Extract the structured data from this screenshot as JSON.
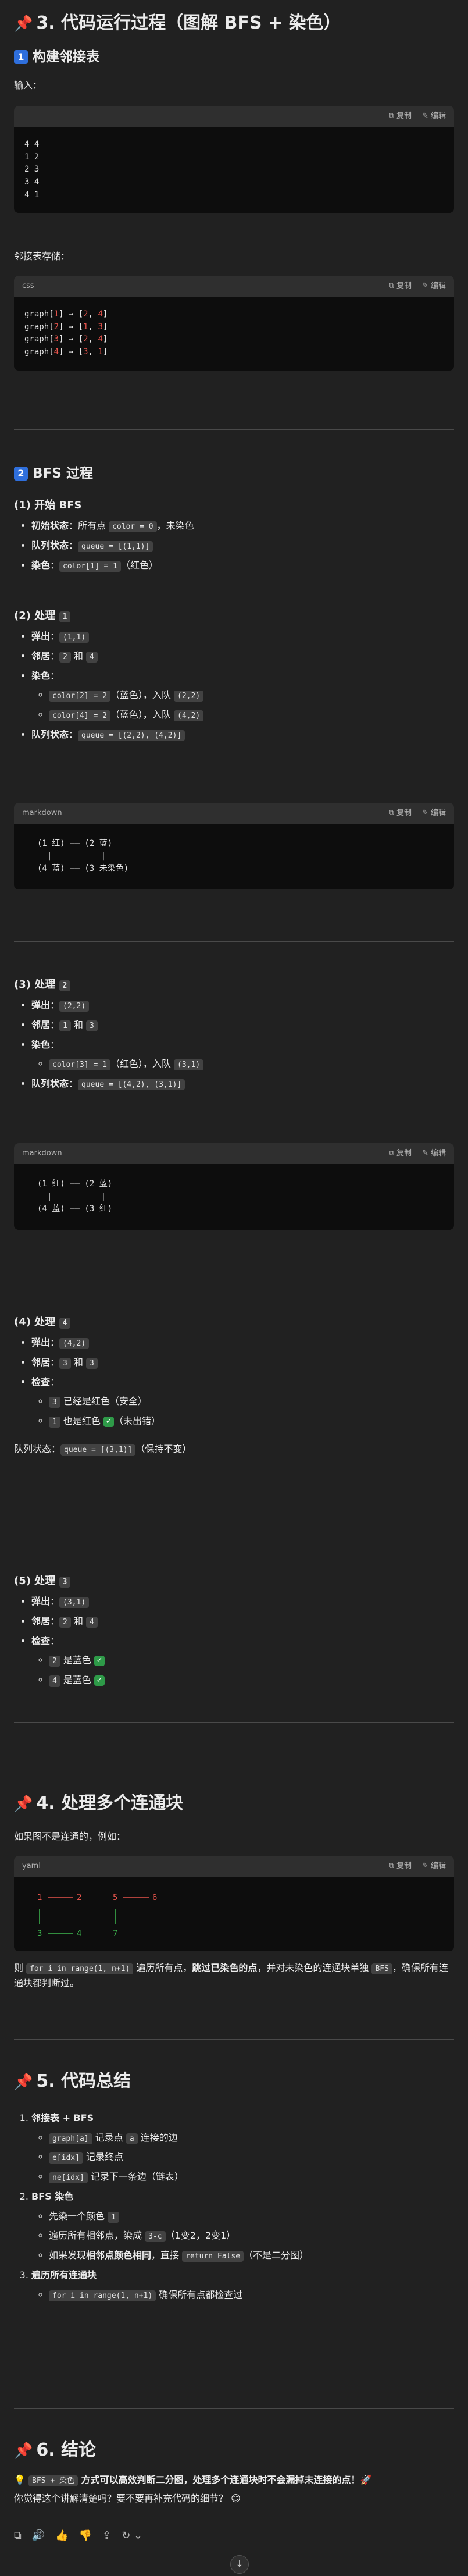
{
  "s3": {
    "title": "3. 代码运行过程（图解 BFS + 染色）",
    "build": {
      "num": "1",
      "title": "构建邻接表"
    },
    "input_label": "输入：",
    "code1": {
      "lang": "",
      "lines": [
        "4 4",
        "1 2",
        "2 3",
        "3 4",
        "4 1"
      ]
    },
    "adj_label": "邻接表存储：",
    "code2": {
      "lang": "css",
      "lines": [
        [
          "graph[",
          "1",
          "] → [",
          "2",
          ", ",
          "4",
          "]"
        ],
        [
          "graph[",
          "2",
          "] → [",
          "1",
          ", ",
          "3",
          "]"
        ],
        [
          "graph[",
          "3",
          "] → [",
          "2",
          ", ",
          "4",
          "]"
        ],
        [
          "graph[",
          "4",
          "] → [",
          "3",
          ", ",
          "1",
          "]"
        ]
      ]
    },
    "bfs": {
      "num": "2",
      "title": "BFS 过程"
    },
    "step1": {
      "title": "(1) 开始 BFS",
      "a_label": "初始状态",
      "a_text": "：所有点 ",
      "a_code": "color = 0",
      "a_tail": "，未染色",
      "b_label": "队列状态",
      "b_text": "：",
      "b_code": "queue = [(1,1)]",
      "c_label": "染色",
      "c_text": "：",
      "c_code": "color[1] = 1",
      "c_tail": "（红色）"
    },
    "step2": {
      "title": "(2) 处理 ",
      "node": "1",
      "pop_label": "弹出",
      "pop_code": "(1,1)",
      "nb_label": "邻居",
      "nb_a": "2",
      "nb_and": " 和 ",
      "nb_b": "4",
      "dye_label": "染色",
      "d1_code": "color[2] = 2",
      "d1_mid": "（蓝色），入队 ",
      "d1_q": "(2,2)",
      "d2_code": "color[4] = 2",
      "d2_mid": "（蓝色），入队 ",
      "d2_q": "(4,2)",
      "q_label": "队列状态",
      "q_code": "queue = [(2,2), (4,2)]",
      "diagram_lang": "markdown",
      "diagram": [
        "(1 红) —— (2 蓝)",
        "  |          |",
        "(4 蓝) —— (3 未染色)"
      ]
    },
    "step3": {
      "title": "(3) 处理 ",
      "node": "2",
      "pop_label": "弹出",
      "pop_code": "(2,2)",
      "nb_label": "邻居",
      "nb_a": "1",
      "nb_and": " 和 ",
      "nb_b": "3",
      "dye_label": "染色",
      "d1_code": "color[3] = 1",
      "d1_mid": "（红色），入队 ",
      "d1_q": "(3,1)",
      "q_label": "队列状态",
      "q_code": "queue = [(4,2), (3,1)]",
      "diagram_lang": "markdown",
      "diagram": [
        "(1 红) —— (2 蓝)",
        "  |          |",
        "(4 蓝) —— (3 红)"
      ]
    },
    "step4": {
      "title": "(4) 处理 ",
      "node": "4",
      "pop_label": "弹出",
      "pop_code": "(4,2)",
      "nb_label": "邻居",
      "nb_a": "3",
      "nb_and": " 和 ",
      "nb_b": "3",
      "check_label": "检查",
      "c1_code": "3",
      "c1_text": " 已经是红色（安全）",
      "c2_code": "1",
      "c2_text": " 也是红色 ",
      "c2_tail": "（未出错）",
      "q_label": "队列状态：",
      "q_code": "queue = [(3,1)]",
      "q_tail": "（保持不变）"
    },
    "step5": {
      "title": "(5) 处理 ",
      "node": "3",
      "pop_label": "弹出",
      "pop_code": "(3,1)",
      "nb_label": "邻居",
      "nb_a": "2",
      "nb_and": " 和 ",
      "nb_b": "4",
      "check_label": "检查",
      "c1_code": "2",
      "c1_text": " 是蓝色 ",
      "c2_code": "4",
      "c2_text": " 是蓝色 "
    }
  },
  "s4": {
    "title": "4. 处理多个连通块",
    "intro": "如果图不是连通的，例如：",
    "code_lang": "yaml",
    "p_pre": "则 ",
    "p_code1": "for i in range(1, n+1)",
    "p_mid": " 遍历所有点，",
    "p_bold": "跳过已染色的点",
    "p_mid2": "，并对未染色的连通块单独 ",
    "p_code2": "BFS",
    "p_tail": "，确保所有连通块都判断过。"
  },
  "s5": {
    "title": "5. 代码总结",
    "i1_title": "邻接表 + BFS",
    "i1_a_code": "graph[a]",
    "i1_a_text": " 记录点 ",
    "i1_a_code2": "a",
    "i1_a_tail": " 连接的边",
    "i1_b_code": "e[idx]",
    "i1_b_text": " 记录终点",
    "i1_c_code": "ne[idx]",
    "i1_c_text": " 记录下一条边（链表）",
    "i2_title": "BFS 染色",
    "i2_a_text": "先染一个颜色 ",
    "i2_a_code": "1",
    "i2_b_text": "遍历所有相邻点，染成 ",
    "i2_b_code": "3-c",
    "i2_b_tail": "（1变2，2变1）",
    "i2_c_text": "如果发现",
    "i2_c_bold": "相邻点颜色相同",
    "i2_c_mid": "，直接 ",
    "i2_c_code": "return False",
    "i2_c_tail": "（不是二分图）",
    "i3_title": "遍历所有连通块",
    "i3_a_code": "for i in range(1, n+1)",
    "i3_a_text": " 确保所有点都检查过"
  },
  "s6": {
    "title": "6. 结论",
    "p_code": "BFS + 染色",
    "p_bold": " 方式可以高效判断二分图，处理多个连通块时不会漏掉未连接的点！",
    "q": "你觉得这个讲解清楚吗？要不要再补充代码的细节？"
  },
  "ui": {
    "copy": "复制",
    "edit": "编辑"
  },
  "icons": {
    "pin": "pushpin-icon",
    "check": "check-mark-icon",
    "rocket": "rocket-icon",
    "bulb": "light-bulb-icon",
    "smile": "smiling-face-icon",
    "down": "arrow-down-icon"
  },
  "colors": {
    "background": "#212121",
    "code_bg": "#0d0d0d",
    "code_head": "#2f2f2f",
    "accent": "#2f6fdc",
    "red": "#e5534b",
    "green": "#3fb950",
    "check": "#2e9a48"
  }
}
